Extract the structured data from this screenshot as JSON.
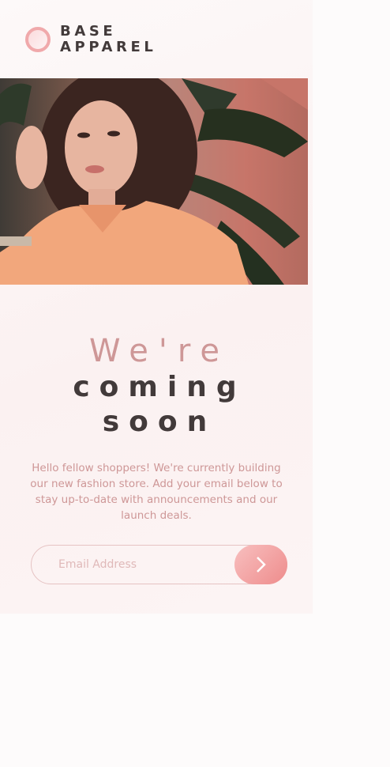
{
  "brand": {
    "line1": "BASE",
    "line2": "APPAREL"
  },
  "hero": {
    "icon": "hero-photo-woman"
  },
  "headline": {
    "light": "We're",
    "dark_line1": "coming",
    "dark_line2": "soon"
  },
  "description": "Hello fellow shoppers! We're currently building our new fashion store. Add your email below to stay up-to-date with announcements and our launch deals.",
  "form": {
    "placeholder": "Email Address",
    "submit_icon": "arrow-right-icon"
  },
  "colors": {
    "accent": "#ce9797",
    "dark_text": "#423a3a",
    "button": "#f0a9ab"
  }
}
